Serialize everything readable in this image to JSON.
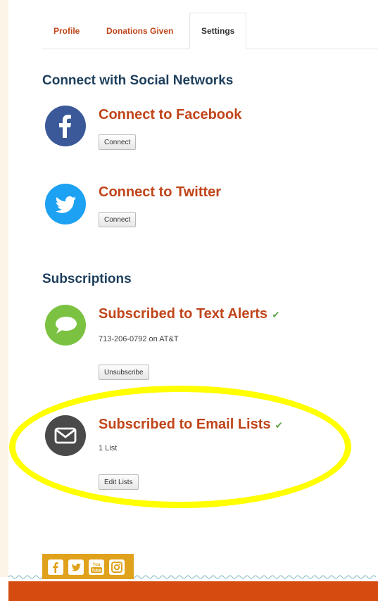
{
  "tabs": [
    {
      "label": "Profile",
      "active": false
    },
    {
      "label": "Donations Given",
      "active": false
    },
    {
      "label": "Settings",
      "active": true
    }
  ],
  "social": {
    "title": "Connect with Social Networks",
    "facebook": {
      "title": "Connect to Facebook",
      "button": "Connect",
      "icon": "facebook-icon",
      "color": "#3b5998"
    },
    "twitter": {
      "title": "Connect to Twitter",
      "button": "Connect",
      "icon": "twitter-icon",
      "color": "#1da1f2"
    }
  },
  "subscriptions": {
    "title": "Subscriptions",
    "text_alerts": {
      "title": "Subscribed to Text Alerts",
      "detail": "713-206-0792 on AT&T",
      "button": "Unsubscribe",
      "icon": "chat-bubble-icon",
      "color": "#7cc242"
    },
    "email_lists": {
      "title": "Subscribed to Email Lists",
      "detail": "1 List",
      "button": "Edit Lists",
      "icon": "envelope-icon",
      "color": "#4a4a4a"
    }
  },
  "footer": {
    "social_icons": [
      "facebook-icon",
      "twitter-icon",
      "youtube-icon",
      "instagram-icon"
    ],
    "youtube_text": "You Tube"
  },
  "colors": {
    "accent": "#c0451a",
    "heading": "#1d3e5c",
    "highlight": "#ffff00",
    "footer": "#d64b10"
  }
}
